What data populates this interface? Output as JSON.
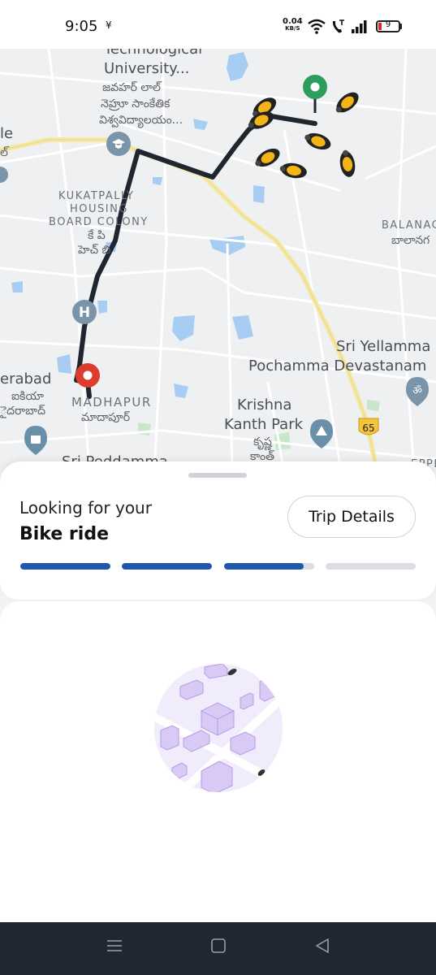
{
  "status_bar": {
    "time": "9:05",
    "vibrate_symbol": "¥",
    "network_speed": "0.04",
    "network_unit": "KB/S",
    "battery_level": "9",
    "icons": [
      "vibrate-icon",
      "wifi-icon",
      "volte-call-icon",
      "signal-icon",
      "battery-icon"
    ]
  },
  "map": {
    "labels": {
      "university_en_1": "Technological",
      "university_en_2": "University...",
      "university_te_1": "జవహర్ లాల్",
      "university_te_2": "నెహ్రూ సాంకేతిక",
      "university_te_3": "విశ్వవిద్యాలయం...",
      "left_edge_1": "le",
      "left_edge_2": "ల్",
      "kukatpally_1": "KUKATPALLY",
      "kukatpally_2": "HOUSING",
      "kukatpally_3": "BOARD COLONY",
      "kukatpally_te_1": "కే పి",
      "kukatpally_te_2": "హెచ్ బి",
      "balanagar": "BALANAG",
      "balanagar_te": "బాలానగ",
      "yellamma_1": "Sri Yellamma",
      "yellamma_2": "Pochamma Devastanam",
      "hyderabad": "erabad",
      "hyderabad_te_1": "ఐకియా",
      "hyderabad_te_2": "ైదరాబాద్",
      "madhapur": "MADHAPUR",
      "madhapur_te": "మాదాపూర్",
      "krishna_1": "Krishna",
      "krishna_2": "Kanth Park",
      "krishna_te_1": "కృష్ణ",
      "krishna_te_2": "కాంత్",
      "bottom_partial": "Sri Peddamma",
      "right_partial": "EPPE",
      "road_shield": "65"
    },
    "icons": [
      "education-pin-icon",
      "hospital-icon",
      "pickup-pin-icon",
      "drop-pin-icon",
      "temple-icon",
      "park-icon",
      "shopping-icon",
      "bike-icon"
    ],
    "route_color": "#1f2630",
    "pickup_color": "#2e9d5c",
    "drop_color": "#dc3b2e"
  },
  "search_panel": {
    "title_line1": "Looking for your",
    "title_line2": "Bike ride",
    "trip_details_label": "Trip Details",
    "progress": [
      1.0,
      1.0,
      0.88,
      0.0
    ],
    "accent_color": "#1f57ab"
  },
  "illustration": {
    "icon": "city-search-illustration",
    "color": "#c9b6f2"
  },
  "nav_bar": {
    "icons": [
      "menu-icon",
      "home-icon",
      "back-icon"
    ]
  }
}
